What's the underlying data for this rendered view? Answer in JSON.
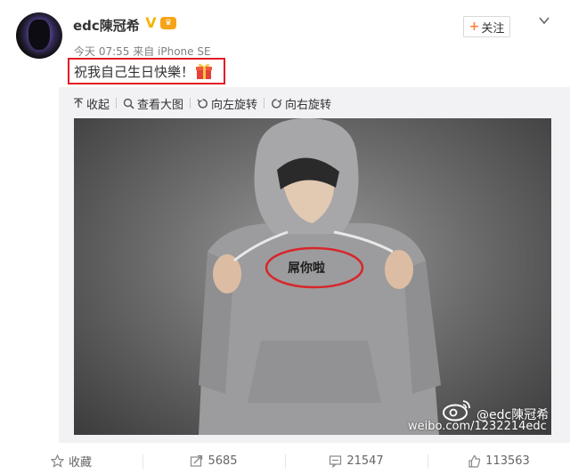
{
  "post": {
    "username": "edc陳冠希",
    "verified_mark": "V",
    "meta": "今天 07:55 来自 iPhone SE",
    "follow_label": "关注",
    "text": "祝我自己生日快樂！"
  },
  "toolbar": {
    "items": [
      {
        "label": "收起",
        "icon": "arrow-up-icon"
      },
      {
        "label": "查看大图",
        "icon": "search-icon"
      },
      {
        "label": "向左旋转",
        "icon": "rotate-left-icon"
      },
      {
        "label": "向右旋转",
        "icon": "rotate-right-icon"
      }
    ]
  },
  "photo": {
    "shirt_text": "屌你啦",
    "watermark_handle": "@edc陳冠希",
    "watermark_url": "weibo.com/1232214edc"
  },
  "actions": {
    "favorite_label": "收藏",
    "repost_count": "5685",
    "comment_count": "21547",
    "like_count": "113563"
  },
  "colors": {
    "highlight_box": "#e21b24",
    "follow_plus": "#ff8140",
    "verified": "#f4b400"
  }
}
